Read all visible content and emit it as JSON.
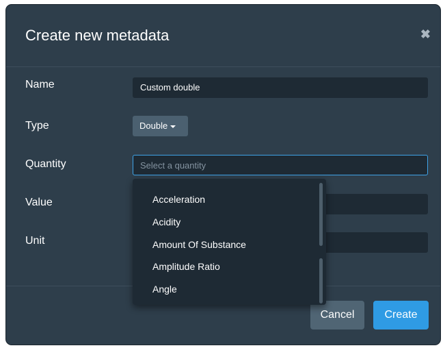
{
  "dialog": {
    "title": "Create new metadata",
    "close_glyph": "✖"
  },
  "form": {
    "name_label": "Name",
    "name_value": "Custom double",
    "type_label": "Type",
    "type_value": "Double",
    "quantity_label": "Quantity",
    "quantity_placeholder": "Select a quantity",
    "value_label": "Value",
    "unit_label": "Unit"
  },
  "dropdown": {
    "items": [
      "Acceleration",
      "Acidity",
      "Amount Of Substance",
      "Amplitude Ratio",
      "Angle"
    ]
  },
  "footer": {
    "cancel_label": "Cancel",
    "create_label": "Create"
  },
  "colors": {
    "modal_bg": "#2e3e4b",
    "input_bg": "#1e2a34",
    "accent": "#2f9be4",
    "focus_border": "#3fa3e8"
  }
}
